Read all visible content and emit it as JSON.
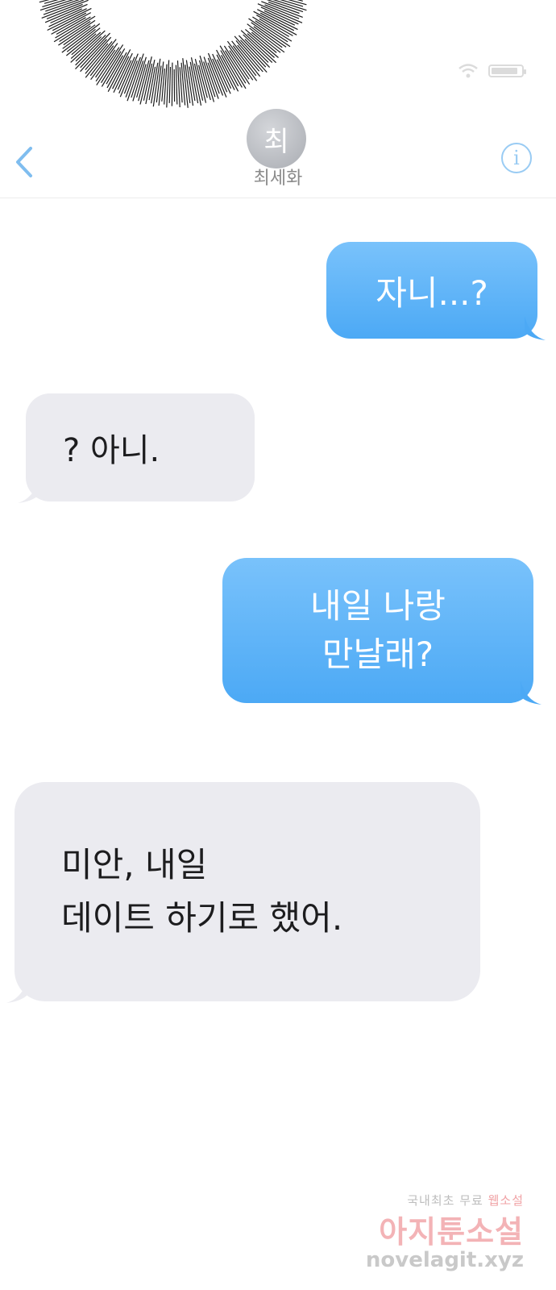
{
  "header": {
    "avatar_initial": "최",
    "contact_name": "최세화",
    "info_label": "i",
    "back_icon": "chevron-left-icon"
  },
  "status": {
    "wifi_icon": "wifi-icon",
    "battery_icon": "battery-icon"
  },
  "colors": {
    "sent_bubble": "#5db3f8",
    "received_bubble": "#ebebf0",
    "accent": "#6fb6ef"
  },
  "messages": [
    {
      "direction": "sent",
      "text": "자니...?"
    },
    {
      "direction": "received",
      "text": "? 아니."
    },
    {
      "direction": "sent",
      "text": "내일 나랑\n만날래?"
    },
    {
      "direction": "received",
      "text": "미안, 내일\n데이트 하기로 했어."
    }
  ],
  "watermark": {
    "line1_a": "국내최초 무료 ",
    "line1_b": "웹소설",
    "line2": "아지툰소설",
    "line3": "novelagit.xyz"
  }
}
